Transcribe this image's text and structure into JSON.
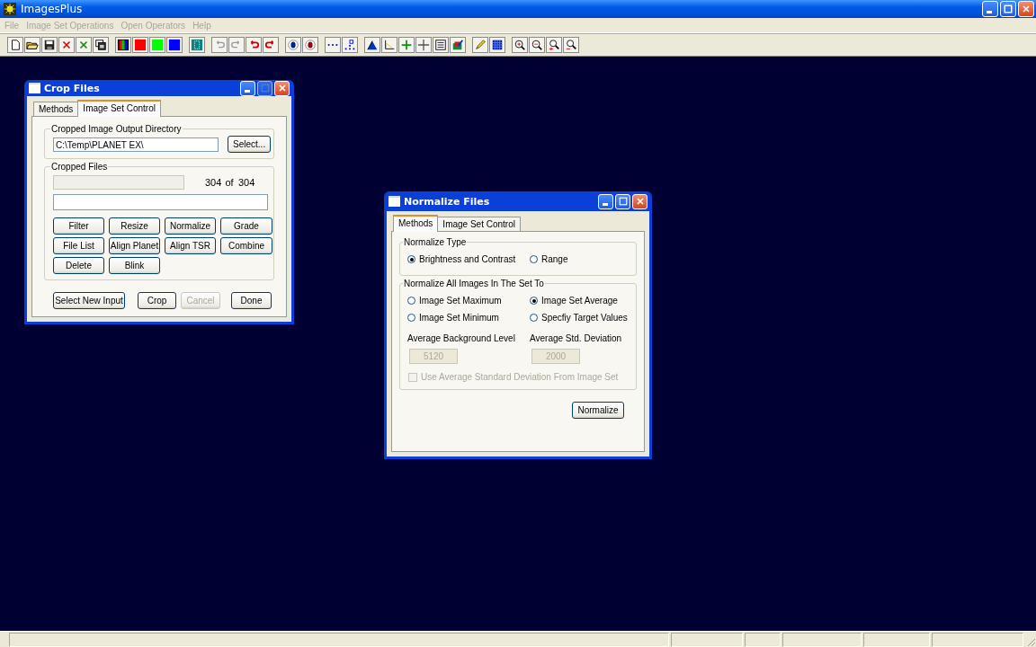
{
  "app": {
    "title": "ImagesPlus"
  },
  "menu": [
    {
      "label": "File",
      "disabled": true
    },
    {
      "label": "Image Set Operations",
      "disabled": true
    },
    {
      "label": "Open Operators",
      "disabled": true
    },
    {
      "label": "Help",
      "disabled": true
    }
  ],
  "crop_window": {
    "title": "Crop Files",
    "tabs": [
      {
        "label": "Methods",
        "selected": false
      },
      {
        "label": "Image Set Control",
        "selected": true
      }
    ],
    "output_directory": {
      "legend": "Cropped Image Output Directory",
      "value": "C:\\Temp\\PLANET EX\\",
      "button": "Select..."
    },
    "cropped_files": {
      "legend": "Cropped Files",
      "count": "304",
      "of": "of",
      "total": "304",
      "buttons": [
        {
          "label": "Filter"
        },
        {
          "label": "Resize"
        },
        {
          "label": "Normalize"
        },
        {
          "label": "Grade"
        },
        {
          "label": "File List"
        },
        {
          "label": "Align Planet"
        },
        {
          "label": "Align TSR"
        },
        {
          "label": "Combine"
        },
        {
          "label": "Delete"
        },
        {
          "label": "Blink"
        }
      ]
    },
    "footer_buttons": [
      {
        "label": "Select New Input",
        "disabled": false
      },
      {
        "label": "Crop",
        "disabled": false
      },
      {
        "label": "Cancel",
        "disabled": true
      },
      {
        "label": "Done",
        "disabled": false
      }
    ]
  },
  "normalize_window": {
    "title": "Normalize Files",
    "tabs": [
      {
        "label": "Methods",
        "selected": true
      },
      {
        "label": "Image Set Control",
        "selected": false
      }
    ],
    "normalize_type": {
      "legend": "Normalize Type",
      "options": [
        {
          "label": "Brightness and Contrast",
          "selected": true
        },
        {
          "label": "Range",
          "selected": false
        }
      ]
    },
    "normalize_to": {
      "legend": "Normalize All Images In The Set To",
      "options": [
        {
          "label": "Image Set Maximum",
          "selected": false
        },
        {
          "label": "Image Set Average",
          "selected": true
        },
        {
          "label": "Image Set Minimum",
          "selected": false
        },
        {
          "label": "Specfiy Target Values",
          "selected": false
        }
      ],
      "fields": [
        {
          "label": "Average Background Level",
          "value": "5120",
          "disabled": true
        },
        {
          "label": "Average Std. Deviation",
          "value": "2000",
          "disabled": true
        }
      ],
      "checkbox": {
        "label": "Use Average Standard Deviation From Image Set",
        "checked": false,
        "disabled": true
      }
    },
    "button": "Normalize"
  }
}
